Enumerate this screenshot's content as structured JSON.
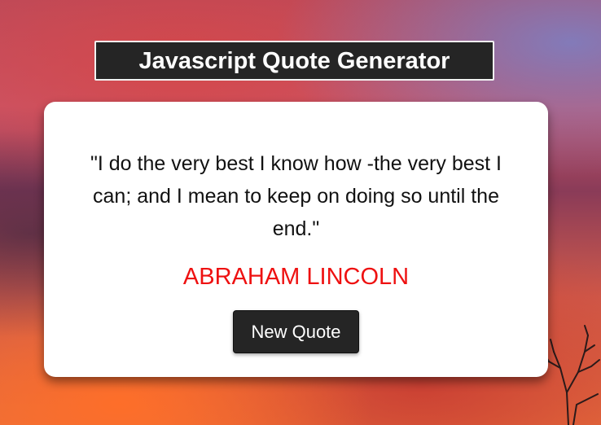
{
  "header": {
    "title": "Javascript Quote Generator"
  },
  "quote_card": {
    "quote_text": "\"I do the very best I know how -the very best I can; and I mean to keep on doing so until the end.\"",
    "author": "ABRAHAM LINCOLN",
    "new_quote_label": "New Quote"
  },
  "colors": {
    "title_bg": "#252525",
    "card_bg": "#ffffff",
    "author_color": "#ee1111",
    "button_bg": "#252525"
  }
}
